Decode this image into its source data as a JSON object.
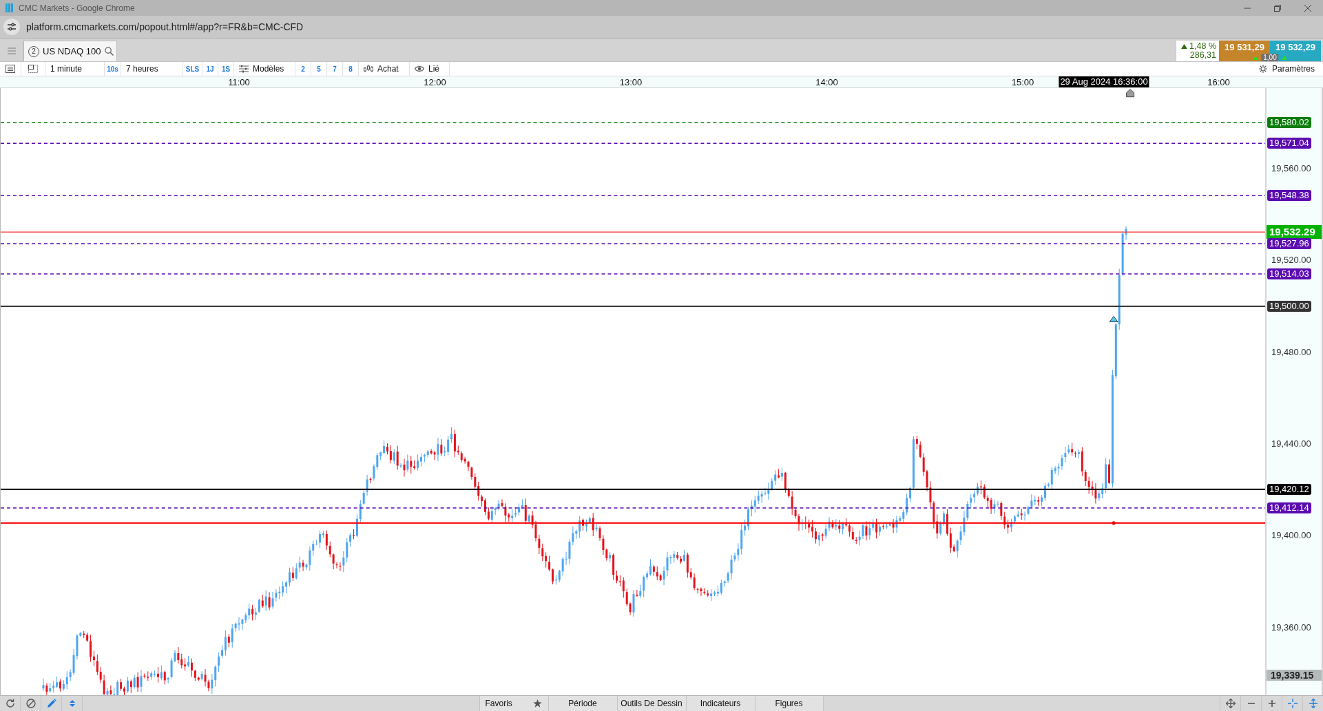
{
  "window": {
    "title": "CMC Markets - Google Chrome"
  },
  "address_bar": {
    "url": "platform.cmcmarkets.com/popout.html#/app?r=FR&b=CMC-CFD"
  },
  "tabs": [
    {
      "number": "2",
      "label": "US NDAQ 100",
      "selected": true
    }
  ],
  "quote": {
    "rising": true,
    "change_percent": "1,48 %",
    "change_points": "286,31",
    "sell": "19 531,29",
    "sell_rising": true,
    "buy": "19 532,29",
    "buy_rising": true,
    "spread": "1,00"
  },
  "toolbar": {
    "interval": "1 minute",
    "interval_shortcut": "10s",
    "range": "7 heures",
    "range_shortcuts": [
      "SLS",
      "1J",
      "1S"
    ],
    "templates": "Modèles",
    "template_slots": [
      "2",
      "5",
      "7",
      "8"
    ],
    "order_side": "Achat",
    "link": "Lié",
    "settings": "Paramètres"
  },
  "time_axis": {
    "labels": [
      "11:00",
      "12:00",
      "13:00",
      "14:00",
      "15:00",
      "16:00"
    ],
    "crosshair_time": "29 Aug 2024 16:36:00"
  },
  "price_axis": {
    "labels": [
      "19,560.00",
      "19,520.00",
      "19,480.00",
      "19,440.00",
      "19,400.00",
      "19,360.00"
    ],
    "crosshair_price": "19,339.15"
  },
  "levels": [
    {
      "kind": "dashed",
      "label": "19,580.02",
      "color": "#0b7d0b"
    },
    {
      "kind": "dashed",
      "label": "19,571.04",
      "color": "#5b0bb0"
    },
    {
      "kind": "dashed",
      "label": "19,548.38",
      "color": "#5b0bb0"
    },
    {
      "kind": "current",
      "label": "19,532.29",
      "color": "#00b200"
    },
    {
      "kind": "dashed",
      "label": "19,527.96",
      "color": "#5b0bb0"
    },
    {
      "kind": "dashed",
      "label": "19,514.03",
      "color": "#5b0bb0"
    },
    {
      "kind": "solid",
      "label": "19,500.00",
      "color": "#333333"
    },
    {
      "kind": "solid",
      "label": "19,420.12",
      "color": "#000000"
    },
    {
      "kind": "dashed",
      "label": "19,412.14",
      "color": "#5b0bb0"
    },
    {
      "kind": "solid",
      "color": "#ff0000"
    }
  ],
  "bottom_bar": {
    "panels": [
      {
        "kind": "favorites",
        "label": "Favoris"
      },
      {
        "kind": "panel",
        "label": "Période"
      },
      {
        "kind": "panel",
        "label": "Outils De Dessin"
      },
      {
        "kind": "panel",
        "label": "Indicateurs"
      },
      {
        "kind": "panel",
        "label": "Figures"
      }
    ]
  }
}
